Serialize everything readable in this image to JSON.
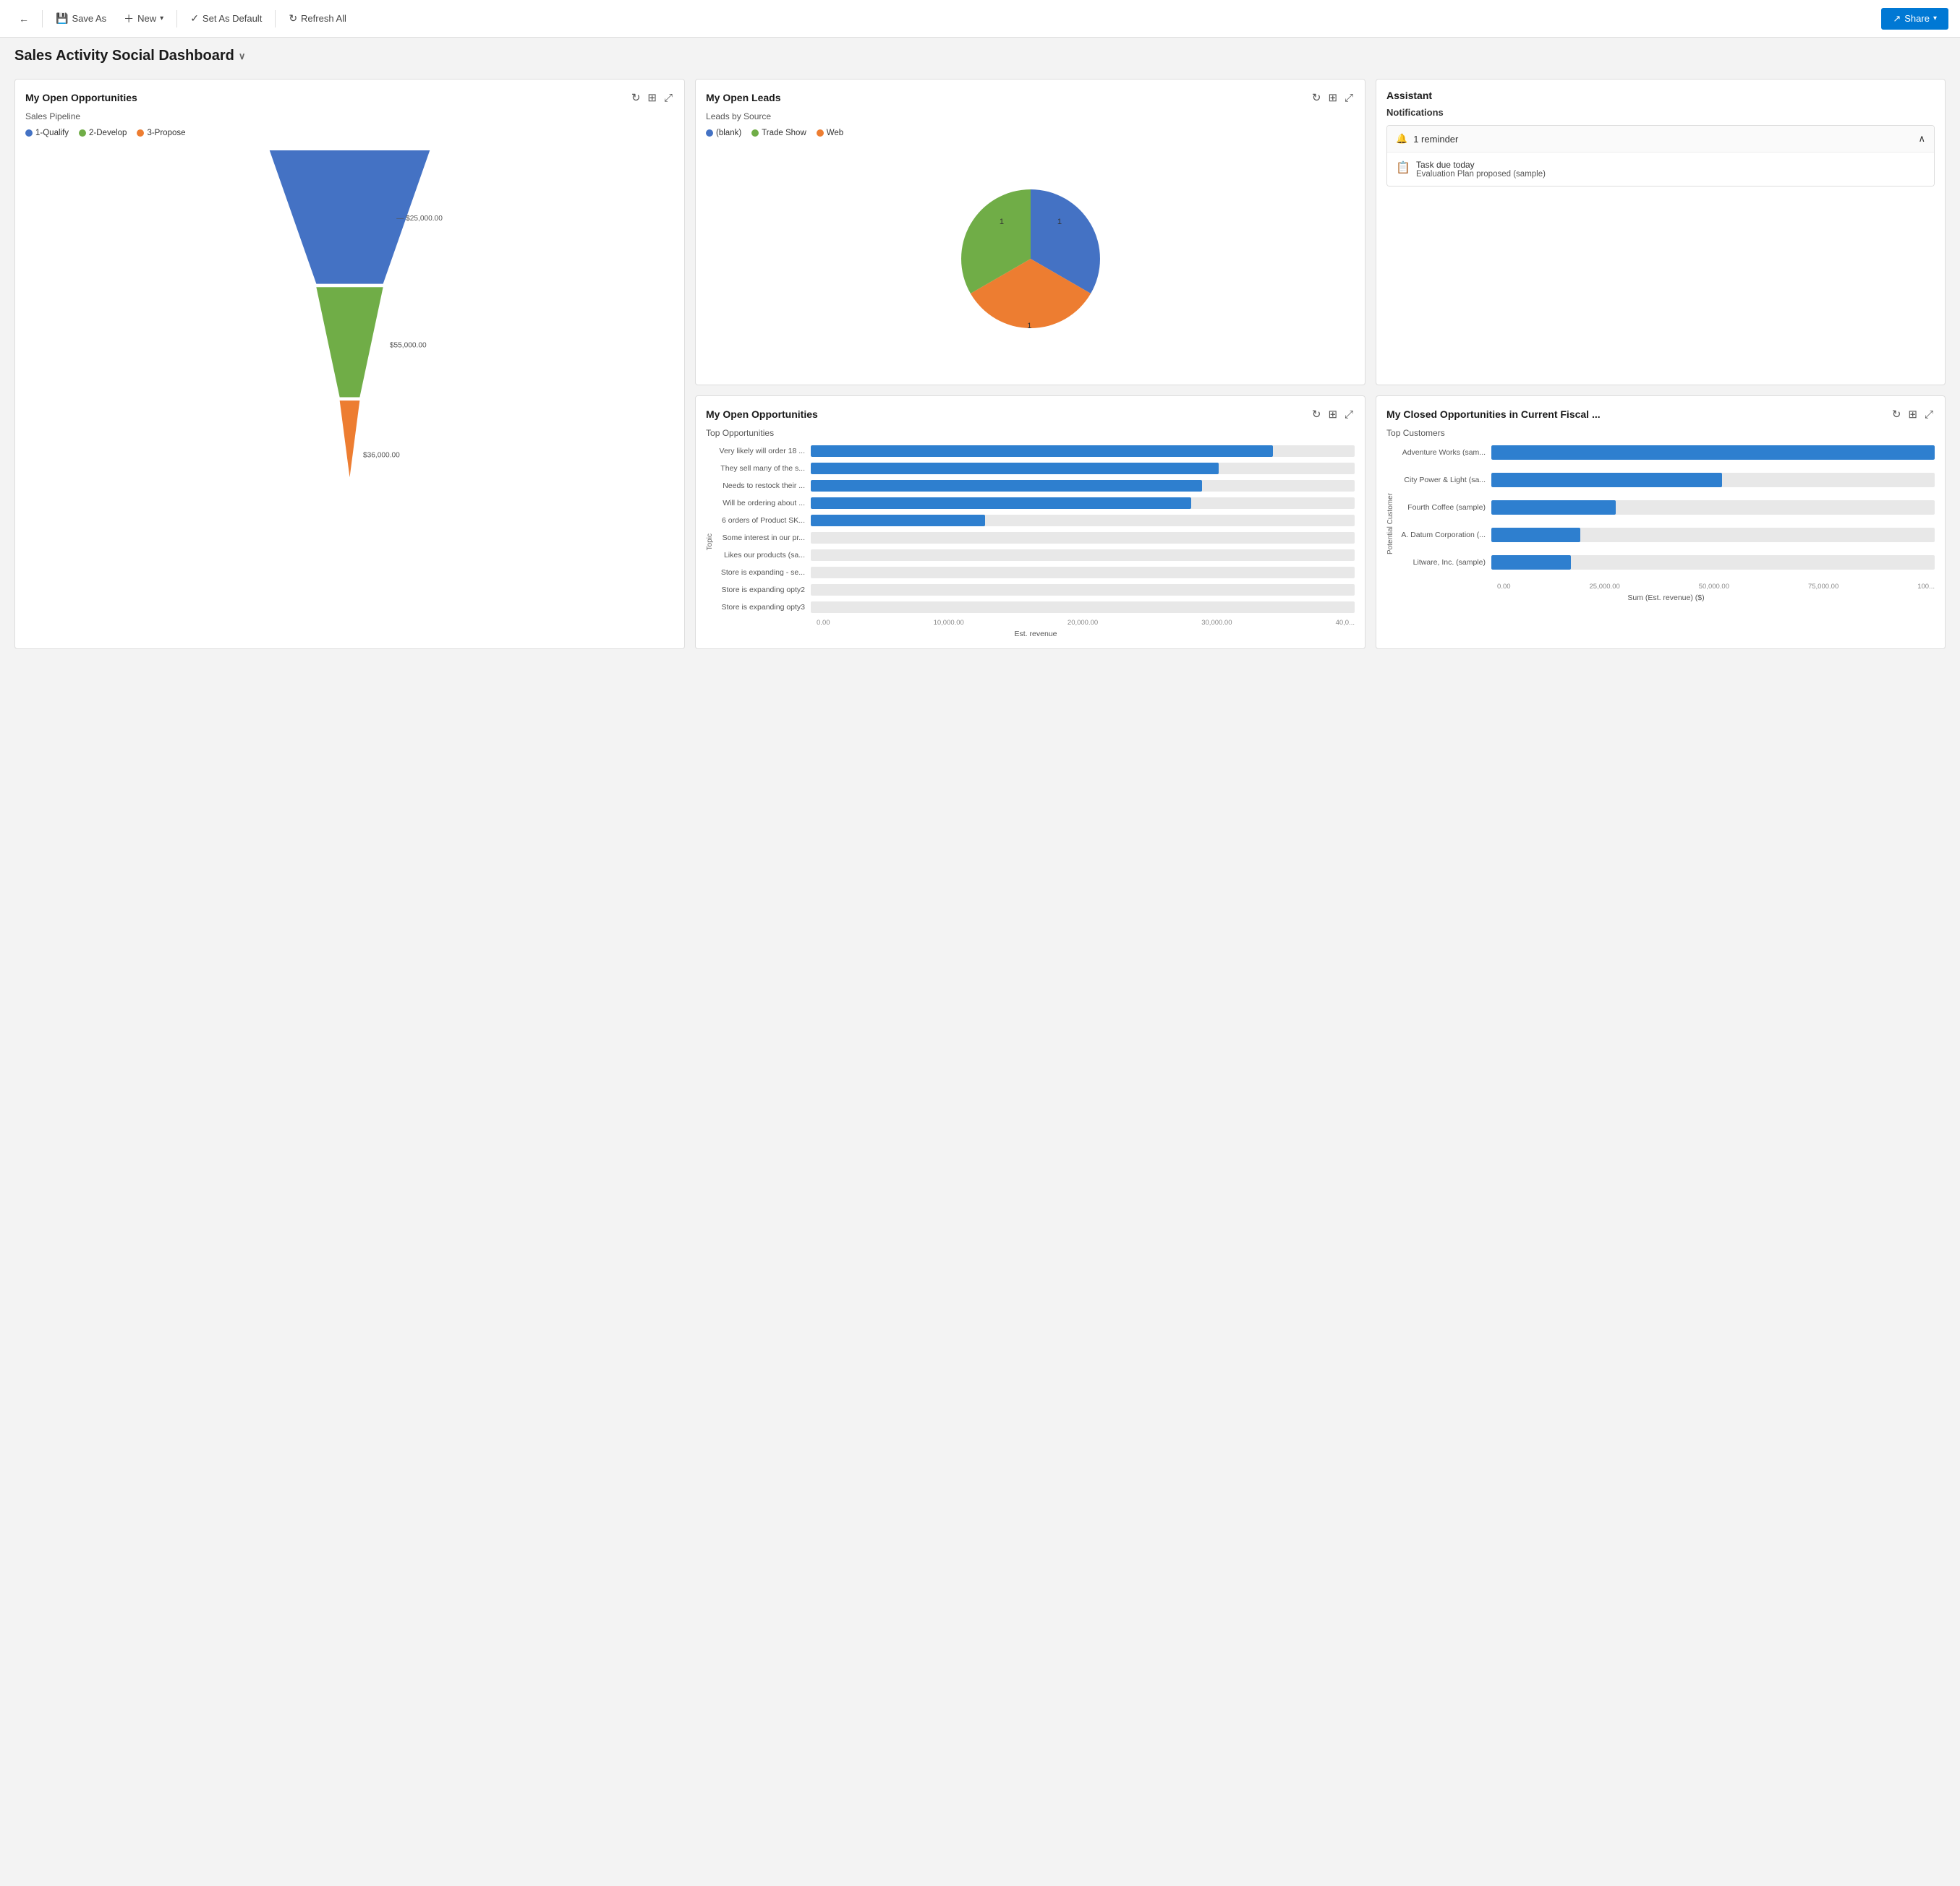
{
  "toolbar": {
    "back_icon": "←",
    "save_as_label": "Save As",
    "new_label": "New",
    "set_default_label": "Set As Default",
    "refresh_all_label": "Refresh All",
    "share_label": "Share"
  },
  "page": {
    "title": "Sales Activity Social Dashboard",
    "title_chevron": "∨"
  },
  "widgets": {
    "open_opportunities": {
      "title": "My Open Opportunities",
      "subtitle": "Sales Pipeline",
      "legend": [
        {
          "label": "1-Qualify",
          "color": "#4472c4"
        },
        {
          "label": "2-Develop",
          "color": "#70ad47"
        },
        {
          "label": "3-Propose",
          "color": "#ed7d31"
        }
      ],
      "funnel": [
        {
          "label": "$25,000.00",
          "color": "#4472c4",
          "widthPct": 100,
          "heightPct": 38
        },
        {
          "label": "$55,000.00",
          "color": "#70ad47",
          "widthPct": 62,
          "heightPct": 38
        },
        {
          "label": "$36,000.00",
          "color": "#ed7d31",
          "widthPct": 25,
          "heightPct": 24
        }
      ]
    },
    "open_leads": {
      "title": "My Open Leads",
      "subtitle": "Leads by Source",
      "legend": [
        {
          "label": "(blank)",
          "color": "#4472c4"
        },
        {
          "label": "Trade Show",
          "color": "#70ad47"
        },
        {
          "label": "Web",
          "color": "#ed7d31"
        }
      ],
      "pie": [
        {
          "label": "blank",
          "value": 1,
          "color": "#4472c4",
          "startAngle": 0,
          "endAngle": 120
        },
        {
          "label": "Trade Show",
          "value": 1,
          "color": "#70ad47",
          "startAngle": 120,
          "endAngle": 240
        },
        {
          "label": "Web",
          "value": 1,
          "color": "#ed7d31",
          "startAngle": 240,
          "endAngle": 360
        }
      ]
    },
    "assistant": {
      "title": "Assistant",
      "notifications_label": "Notifications",
      "reminder_count": "1 reminder",
      "reminder_icon": "🔔",
      "reminder_chevron": "∧",
      "task_label": "Task due today",
      "task_detail": "Evaluation Plan proposed (sample)",
      "task_icon": "📋"
    },
    "top_opportunities": {
      "title": "My Open Opportunities",
      "subtitle": "Top Opportunities",
      "y_axis_label": "Topic",
      "x_axis_label": "Est. revenue",
      "bars": [
        {
          "label": "Very likely will order 18 ...",
          "value": 85,
          "display": ""
        },
        {
          "label": "They sell many of the s...",
          "value": 75,
          "display": ""
        },
        {
          "label": "Needs to restock their ...",
          "value": 72,
          "display": ""
        },
        {
          "label": "Will be ordering about ...",
          "value": 70,
          "display": ""
        },
        {
          "label": "6 orders of Product SK...",
          "value": 32,
          "display": ""
        },
        {
          "label": "Some interest in our pr...",
          "value": 0,
          "display": ""
        },
        {
          "label": "Likes our products (sa...",
          "value": 0,
          "display": ""
        },
        {
          "label": "Store is expanding - se...",
          "value": 0,
          "display": ""
        },
        {
          "label": "Store is expanding opty2",
          "value": 0,
          "display": ""
        },
        {
          "label": "Store is expanding opty3",
          "value": 0,
          "display": ""
        }
      ],
      "x_axis_ticks": [
        "0.00",
        "10,000.00",
        "20,000.00",
        "30,000.00",
        "40,0..."
      ]
    },
    "closed_opportunities": {
      "title": "My Closed Opportunities in Current Fiscal ...",
      "subtitle": "Top Customers",
      "y_axis_label": "Potential Customer",
      "x_axis_label": "Sum (Est. revenue) ($)",
      "bars": [
        {
          "label": "Adventure Works (sam...",
          "value": 100,
          "display": ""
        },
        {
          "label": "City Power & Light (sa...",
          "value": 52,
          "display": ""
        },
        {
          "label": "Fourth Coffee (sample)",
          "value": 28,
          "display": ""
        },
        {
          "label": "A. Datum Corporation (...",
          "value": 20,
          "display": ""
        },
        {
          "label": "Litware, Inc. (sample)",
          "value": 18,
          "display": ""
        }
      ],
      "x_axis_ticks": [
        "0.00",
        "25,000.00",
        "50,000.00",
        "75,000.00",
        "100..."
      ]
    }
  }
}
